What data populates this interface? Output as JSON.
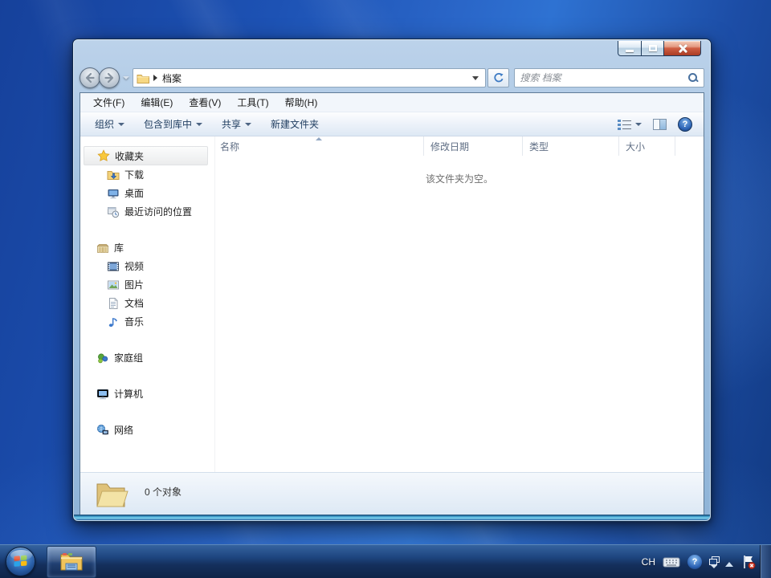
{
  "window": {
    "controls": {
      "minimize": "minimize",
      "maximize": "maximize",
      "close": "close"
    }
  },
  "nav": {
    "breadcrumb_folder": "档案",
    "search_placeholder": "搜索 档案"
  },
  "menubar": {
    "items": [
      {
        "label": "文件(F)"
      },
      {
        "label": "编辑(E)"
      },
      {
        "label": "查看(V)"
      },
      {
        "label": "工具(T)"
      },
      {
        "label": "帮助(H)"
      }
    ]
  },
  "toolbar": {
    "buttons": [
      {
        "label": "组织",
        "has_dropdown": true
      },
      {
        "label": "包含到库中",
        "has_dropdown": true
      },
      {
        "label": "共享",
        "has_dropdown": true
      },
      {
        "label": "新建文件夹",
        "has_dropdown": false
      }
    ]
  },
  "file_list": {
    "columns": [
      {
        "label": "名称",
        "sorted": "asc"
      },
      {
        "label": "修改日期"
      },
      {
        "label": "类型"
      },
      {
        "label": "大小"
      }
    ],
    "empty_message": "该文件夹为空。"
  },
  "sidebar": {
    "sections": [
      {
        "label": "收藏夹",
        "icon": "star-icon",
        "selected": true,
        "children": [
          {
            "label": "下载",
            "icon": "downloads-folder-icon"
          },
          {
            "label": "桌面",
            "icon": "desktop-icon"
          },
          {
            "label": "最近访问的位置",
            "icon": "recent-places-icon"
          }
        ]
      },
      {
        "label": "库",
        "icon": "libraries-icon",
        "children": [
          {
            "label": "视频",
            "icon": "videos-icon"
          },
          {
            "label": "图片",
            "icon": "pictures-icon"
          },
          {
            "label": "文档",
            "icon": "documents-icon"
          },
          {
            "label": "音乐",
            "icon": "music-icon"
          }
        ]
      },
      {
        "label": "家庭组",
        "icon": "homegroup-icon",
        "children": []
      },
      {
        "label": "计算机",
        "icon": "computer-icon",
        "children": []
      },
      {
        "label": "网络",
        "icon": "network-icon",
        "children": []
      }
    ]
  },
  "details_pane": {
    "item_count": "0 个对象"
  },
  "taskbar": {
    "tray": {
      "input_indicator": "CH"
    }
  },
  "icons": {
    "help_glyph": "?"
  },
  "colors": {
    "close_red": "#c4492f",
    "desktop_blue": "#2a66c8",
    "taskbar_navy": "#142f5c",
    "glass_blue": "#a5c4e2"
  }
}
